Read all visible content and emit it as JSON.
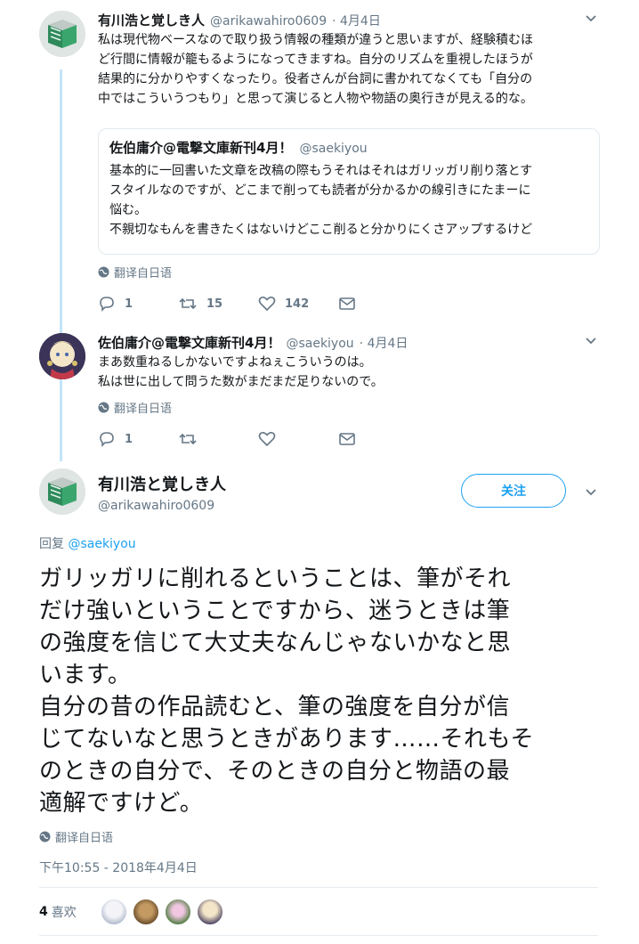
{
  "thread": {
    "tweet1": {
      "display_name": "有川浩と覚しき人",
      "handle": "@arikawahiro0609",
      "date": "· 4月4日",
      "lines": [
        "私は現代物ベースなので取り扱う情報の種類が違うと思いますが、経験積むほ",
        "ど行間に情報が籠もるようになってきますね。自分のリズムを重視したほうが",
        "結果的に分かりやすくなったり。役者さんが台詞に書かれてなくても「自分の",
        "中ではこういうつもり」と思って演じると人物や物語の奥行きが見える的な。"
      ],
      "quote": {
        "display_name": "佐伯庸介@電撃文庫新刊4月！",
        "handle": "@saekiyou",
        "lines": [
          "基本的に一回書いた文章を改稿の際もうそれはそれはガリッガリ削り落とす",
          "スタイルなのですが、どこまで削っても読者が分かるかの線引きにたまーに",
          "悩む。",
          "不親切なもんを書きたくはないけどここ削ると分かりにくさアップするけど"
        ]
      },
      "translate": "翻译自日语",
      "replies": "1",
      "retweets": "15",
      "likes": "142"
    },
    "tweet2": {
      "display_name": "佐伯庸介@電撃文庫新刊4月！",
      "handle": "@saekiyou",
      "date": "· 4月4日",
      "lines": [
        "まあ数重ねるしかないですよねぇこういうのは。",
        "私は世に出して問うた数がまだまだ足りないので。"
      ],
      "translate": "翻译自日语",
      "replies": "1"
    }
  },
  "main": {
    "display_name": "有川浩と覚しき人",
    "handle": "@arikawahiro0609",
    "follow_label": "关注",
    "reply_prefix": "回复",
    "reply_to": "@saekiyou",
    "lines": [
      "ガリッガリに削れるということは、筆がそれ",
      "だけ強いということですから、迷うときは筆",
      "の強度を信じて大丈夫なんじゃないかなと思",
      "います。",
      "自分の昔の作品読むと、筆の強度を自分が信",
      "じてないなと思うときがあります……それもそ",
      "のときの自分で、そのときの自分と物語の最",
      "適解ですけど。"
    ],
    "translate": "翻译自日语",
    "timestamp": "下午10:55 - 2018年4月4日",
    "likes_count": "4",
    "likes_label": "喜欢"
  },
  "colors": {
    "accent": "#1da1f2",
    "thread_line": "#c4e4f8",
    "muted": "#657786",
    "border": "#e1e8ed"
  }
}
